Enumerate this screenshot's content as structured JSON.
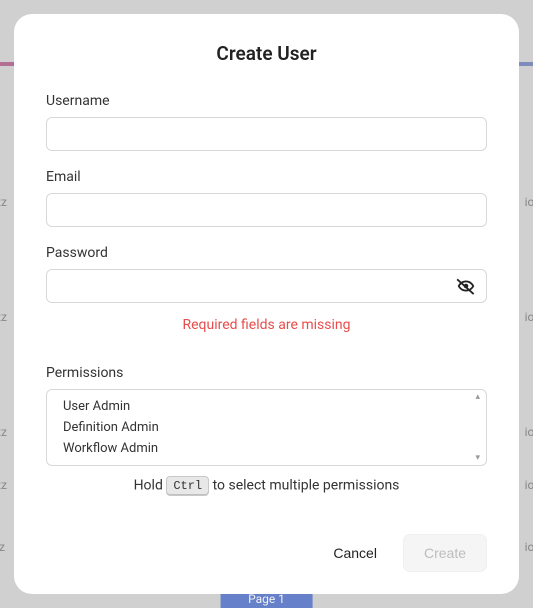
{
  "modal": {
    "title": "Create User",
    "fields": {
      "username": {
        "label": "Username",
        "value": ""
      },
      "email": {
        "label": "Email",
        "value": ""
      },
      "password": {
        "label": "Password",
        "value": ""
      },
      "permissions": {
        "label": "Permissions"
      }
    },
    "error": "Required fields are missing",
    "permissions_options": [
      "User Admin",
      "Definition Admin",
      "Workflow Admin"
    ],
    "hint_prefix": "Hold ",
    "hint_kbd": "Ctrl",
    "hint_suffix": " to select multiple permissions",
    "buttons": {
      "cancel": "Cancel",
      "create": "Create"
    }
  },
  "backdrop": {
    "pager": "Page  1"
  }
}
